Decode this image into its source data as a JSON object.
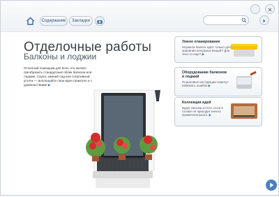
{
  "toolbar": {
    "contents_label": "Содержание",
    "bookmarks_label": "Закладки",
    "search_placeholder": ""
  },
  "main": {
    "title": "Отделочные работы",
    "subtitle": "Балконы и лоджии",
    "lead_text": "Отличный помощник для всех, кто желает преобразить стандартный облик балкона или лоджии. Сауна, зимний сад или спортивный уголок — воплощайте свои идеи грамотно и с удовольствием!",
    "lead_arrow": "▶"
  },
  "cards": [
    {
      "title": "Умное планирование",
      "body": "Неужели балкон ждет только для хранения ненужных вещей? Для чего-то еще?",
      "cta": "▶"
    },
    {
      "title": "Оборудование балконов и лоджий",
      "body": "Пошаговые инструкции помогут избежать ошибок",
      "cta": "▶"
    },
    {
      "title": "Коллекция идей",
      "body": "Будет весьма кстати, если в голове не приходит ничего примечательного.",
      "cta": "▶"
    }
  ],
  "colors": {
    "accent": "#3e6fa9",
    "text_dark": "#3b3f44",
    "frame_border": "#c9d1d9"
  }
}
